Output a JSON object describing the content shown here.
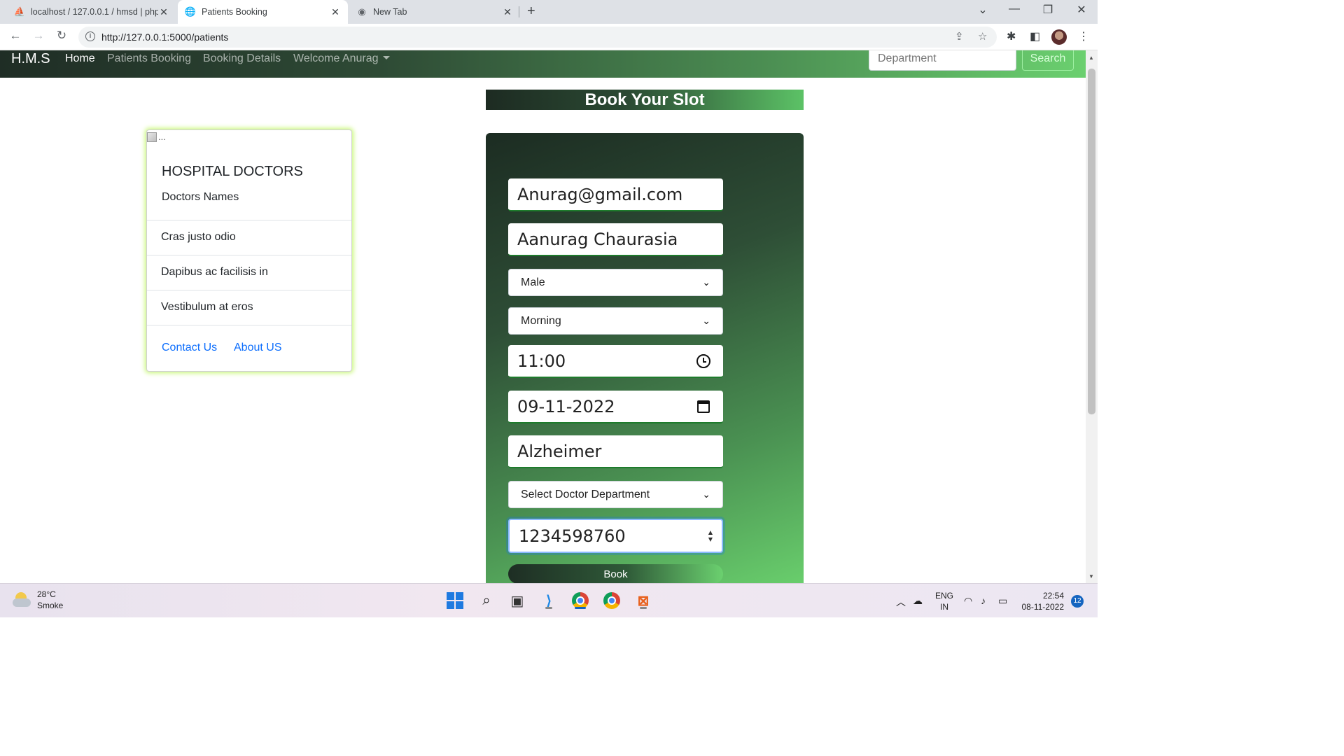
{
  "browser": {
    "tabs": [
      {
        "title": "localhost / 127.0.0.1 / hmsd | php",
        "icon": "phpmyadmin-icon",
        "active": false
      },
      {
        "title": "Patients Booking",
        "icon": "globe-icon",
        "active": true
      },
      {
        "title": "New Tab",
        "icon": "chrome-icon",
        "active": false
      }
    ],
    "url": "http://127.0.0.1:5000/patients"
  },
  "navbar": {
    "brand": "H.M.S",
    "links": [
      "Home",
      "Patients Booking",
      "Booking Details",
      "Welcome Anurag"
    ],
    "search_placeholder": "Department",
    "search_button": "Search"
  },
  "card": {
    "image_alt": "...",
    "title": "HOSPITAL DOCTORS",
    "text": "Doctors Names",
    "items": [
      "Cras justo odio",
      "Dapibus ac facilisis in",
      "Vestibulum at eros"
    ],
    "links": [
      "Contact Us",
      "About US"
    ]
  },
  "booking": {
    "title": "Book Your Slot",
    "email": "Anurag@gmail.com",
    "name": "Aanurag Chaurasia",
    "gender": "Male",
    "slot": "Morning",
    "time": "11:00",
    "date": "09-11-2022",
    "disease": "Alzheimer",
    "department": "Select Doctor Department",
    "phone": "1234598760",
    "button": "Book"
  },
  "taskbar": {
    "temperature": "28°C",
    "weather": "Smoke",
    "language": "ENG",
    "region": "IN",
    "time": "22:54",
    "date": "08-11-2022",
    "notifications": "12"
  }
}
